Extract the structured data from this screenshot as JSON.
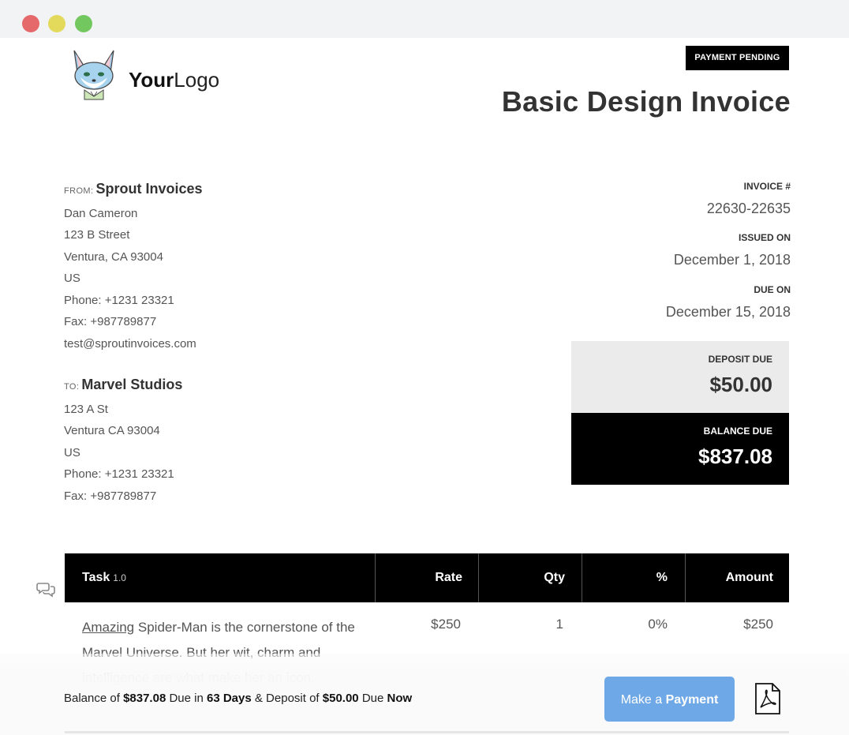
{
  "status_badge": "PAYMENT PENDING",
  "logo": {
    "bold": "Your",
    "light": "Logo"
  },
  "title": "Basic Design Invoice",
  "from": {
    "label": "FROM:",
    "company": "Sprout Invoices",
    "lines": [
      "Dan Cameron",
      "123 B Street",
      "Ventura, CA 93004",
      "US",
      "Phone: +1231 23321",
      "Fax: +987789877",
      "test@sproutinvoices.com"
    ]
  },
  "to": {
    "label": "TO:",
    "company": "Marvel Studios",
    "lines": [
      "123 A St",
      "Ventura CA 93004",
      "US",
      "Phone: +1231 23321",
      "Fax: +987789877"
    ]
  },
  "meta": {
    "invoice_label": "INVOICE #",
    "invoice_number": "22630-22635",
    "issued_label": "ISSUED ON",
    "issued_date": "December 1, 2018",
    "due_label": "DUE ON",
    "due_date": "December 15, 2018"
  },
  "deposit": {
    "label": "DEPOSIT DUE",
    "amount": "$50.00"
  },
  "balance": {
    "label": "BALANCE DUE",
    "amount": "$837.08"
  },
  "table": {
    "headers": {
      "task": "Task",
      "version": "1.0",
      "rate": "Rate",
      "qty": "Qty",
      "pct": "%",
      "amount": "Amount"
    },
    "row": {
      "desc_link": "Amazing",
      "desc_rest": "Spider-Man is the cornerstone of the Marvel Universe. But her wit, charm and intelligence are what make her an icon.",
      "rate": "$250",
      "qty": "1",
      "pct": "0%",
      "amount": "$250"
    }
  },
  "footer": {
    "p1": "Balance of ",
    "balance": "$837.08",
    "p2": " Due in ",
    "days": "63 Days",
    "p3": " & Deposit of ",
    "deposit": "$50.00",
    "p4": " Due ",
    "now": "Now",
    "pay_prefix": "Make a",
    "pay_bold": "Payment"
  },
  "icons": {
    "chat": "chat-bubbles-icon",
    "pdf": "pdf-icon"
  },
  "colors": {
    "accent": "#6fa8e6",
    "dark": "#000000"
  }
}
